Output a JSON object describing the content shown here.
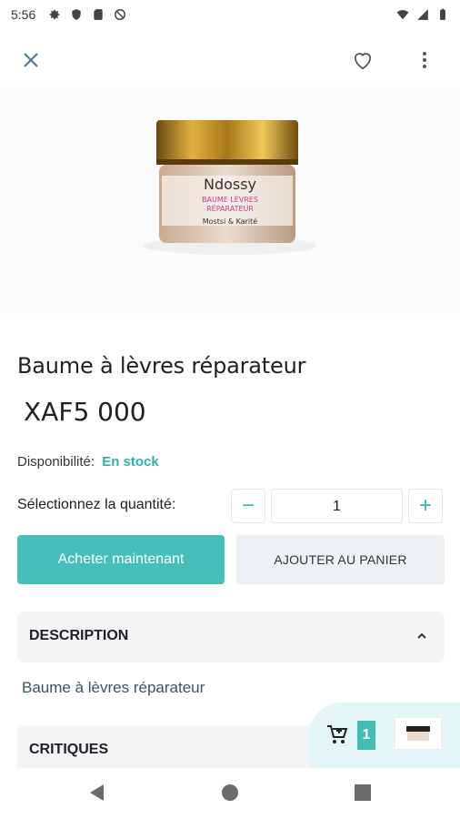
{
  "status_bar": {
    "time": "5:56",
    "left_icons": [
      "gear-icon",
      "shield-icon",
      "sd-card-icon",
      "no-data-icon"
    ],
    "right_icons": [
      "wifi-icon",
      "signal-icon",
      "battery-icon"
    ]
  },
  "top_bar": {
    "close_icon": "close-icon",
    "favorite_icon": "heart-outline-icon",
    "more_icon": "more-vertical-icon"
  },
  "product": {
    "image_brand": "Ndossy",
    "image_line1": "BAUME LÈVRES",
    "image_line2": "RÉPARATEUR",
    "image_sub": "Mostsi & Karité",
    "title": "Baume à lèvres réparateur",
    "price": "XAF5 000",
    "availability_label": "Disponibilité:",
    "availability_value": "En stock"
  },
  "quantity": {
    "label": "Sélectionnez la quantité:",
    "value": "1",
    "minus": "−",
    "plus": "+"
  },
  "actions": {
    "buy_now": "Acheter maintenant",
    "add_to_cart": "AJOUTER AU PANIER"
  },
  "description": {
    "header": "DESCRIPTION",
    "text": "Baume à lèvres réparateur"
  },
  "reviews": {
    "header": "CRITIQUES"
  },
  "cart_bubble": {
    "count": "1"
  },
  "colors": {
    "accent": "#45bfb9",
    "stock": "#2fb2ab",
    "panel": "#f3f5f7"
  }
}
